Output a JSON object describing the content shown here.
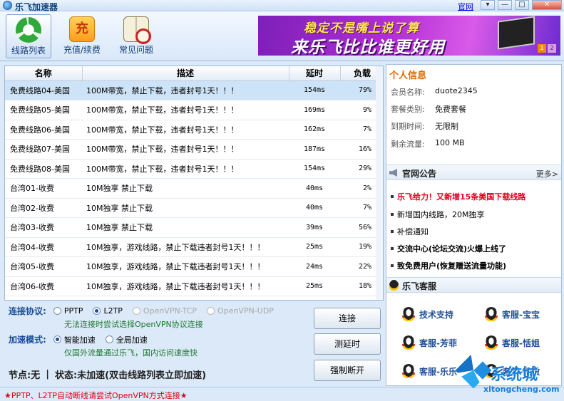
{
  "app": {
    "title": "乐飞加速器",
    "official_link": "官网",
    "window_buttons": [
      "▾",
      "—",
      "□",
      "✕"
    ]
  },
  "toolbar": {
    "items": [
      {
        "label": "线路列表",
        "icon": "recycle-icon",
        "active": true
      },
      {
        "label": "充值/续费",
        "icon": "recharge-icon",
        "glyph": "充",
        "active": false
      },
      {
        "label": "常见问题",
        "icon": "book-magnifier-icon",
        "active": false
      }
    ]
  },
  "banner": {
    "line1": "稳定不是嘴上说了算",
    "line2": "来乐飞比比谁更好用",
    "pages": [
      "1",
      "2"
    ],
    "current_page": 1
  },
  "server_table": {
    "headers": [
      "名称",
      "描述",
      "延时",
      "负载"
    ],
    "rows": [
      {
        "name": "免费线路04-美国",
        "desc": "100M带宽，禁止下载，违者封号1天！！！",
        "latency": "154ms",
        "load": "79%",
        "selected": true
      },
      {
        "name": "免费线路05-美国",
        "desc": "100M带宽，禁止下载，违者封号1天！！！",
        "latency": "169ms",
        "load": "9%"
      },
      {
        "name": "免费线路06-美国",
        "desc": "100M带宽，禁止下载，违者封号1天！！！",
        "latency": "162ms",
        "load": "7%"
      },
      {
        "name": "免费线路07-美国",
        "desc": "100M带宽，禁止下载，违者封号1天！！！",
        "latency": "187ms",
        "load": "16%"
      },
      {
        "name": "免费线路08-美国",
        "desc": "100M带宽，禁止下载，违者封号1天！！！",
        "latency": "154ms",
        "load": "29%"
      },
      {
        "name": "台湾01-收费",
        "desc": "10M独享  禁止下载",
        "latency": "40ms",
        "load": "2%"
      },
      {
        "name": "台湾02-收费",
        "desc": "10M独享  禁止下载",
        "latency": "40ms",
        "load": "7%"
      },
      {
        "name": "台湾03-收费",
        "desc": "10M独享  禁止下载",
        "latency": "39ms",
        "load": "56%"
      },
      {
        "name": "台湾04-收费",
        "desc": "10M独享，游戏线路，禁止下载违者封号1天！！！",
        "latency": "25ms",
        "load": "19%"
      },
      {
        "name": "台湾05-收费",
        "desc": "10M独享，游戏线路，禁止下载违者封号1天！！！",
        "latency": "24ms",
        "load": "22%"
      },
      {
        "name": "台湾06-收费",
        "desc": "10M独享，游戏线路，禁止下载违者封号1天！！！",
        "latency": "25ms",
        "load": "18%"
      }
    ]
  },
  "connection": {
    "protocol_label": "连接协议:",
    "protocols": [
      {
        "label": "PPTP",
        "checked": false,
        "disabled": false
      },
      {
        "label": "L2TP",
        "checked": true,
        "disabled": false
      },
      {
        "label": "OpenVPN-TCP",
        "checked": false,
        "disabled": true
      },
      {
        "label": "OpenVPN-UDP",
        "checked": false,
        "disabled": true
      }
    ],
    "protocol_hint": "无法连接时尝试选择OpenVPN协议连接",
    "mode_label": "加速模式:",
    "modes": [
      {
        "label": "智能加速",
        "checked": true
      },
      {
        "label": "全局加速",
        "checked": false
      }
    ],
    "mode_hint": "仅国外流量通过乐飞，国内访问速度快",
    "node_text": "节点:无",
    "status_sep": "|",
    "status_text": "状态:未加速(双击线路列表立即加速)",
    "buttons": {
      "connect": "连接",
      "test_latency": "测延时",
      "force_disconnect": "强制断开"
    }
  },
  "footer": {
    "notice": "★PPTP、L2TP自动断线请尝试OpenVPN方式连接★"
  },
  "personal": {
    "title": "个人信息",
    "fields": [
      {
        "key": "会员名称:",
        "value": "duote2345"
      },
      {
        "key": "套餐类别:",
        "value": "免费套餐"
      },
      {
        "key": "到期时间:",
        "value": "无限制"
      },
      {
        "key": "剩余流量:",
        "value": "100 MB"
      }
    ]
  },
  "announcements": {
    "title": "官网公告",
    "more": "更多>",
    "items": [
      {
        "text": "乐飞给力！又新增15条美国下载线路",
        "style": "red"
      },
      {
        "text": "新增国内线路，20M独享",
        "style": "normal"
      },
      {
        "text": "补偿通知",
        "style": "normal"
      },
      {
        "text": "交流中心(论坛交流)火爆上线了",
        "style": "bold"
      },
      {
        "text": "致免费用户(恢复赠送流量功能)",
        "style": "bold"
      }
    ]
  },
  "customer_service": {
    "title": "乐飞客服",
    "agents": [
      "技术支持",
      "客服-宝宝",
      "客服-芳菲",
      "客服-恬姐",
      "客服-乐乐",
      "客服-微微"
    ]
  },
  "watermark": {
    "name": "系统城",
    "url": "xitongcheng.com"
  },
  "colors": {
    "accent_blue": "#1a4d96",
    "orange_title": "#e06a00",
    "notice_red": "#e0001a",
    "hint_green": "#1d7a2f",
    "selected_row": "#cde3f7"
  }
}
